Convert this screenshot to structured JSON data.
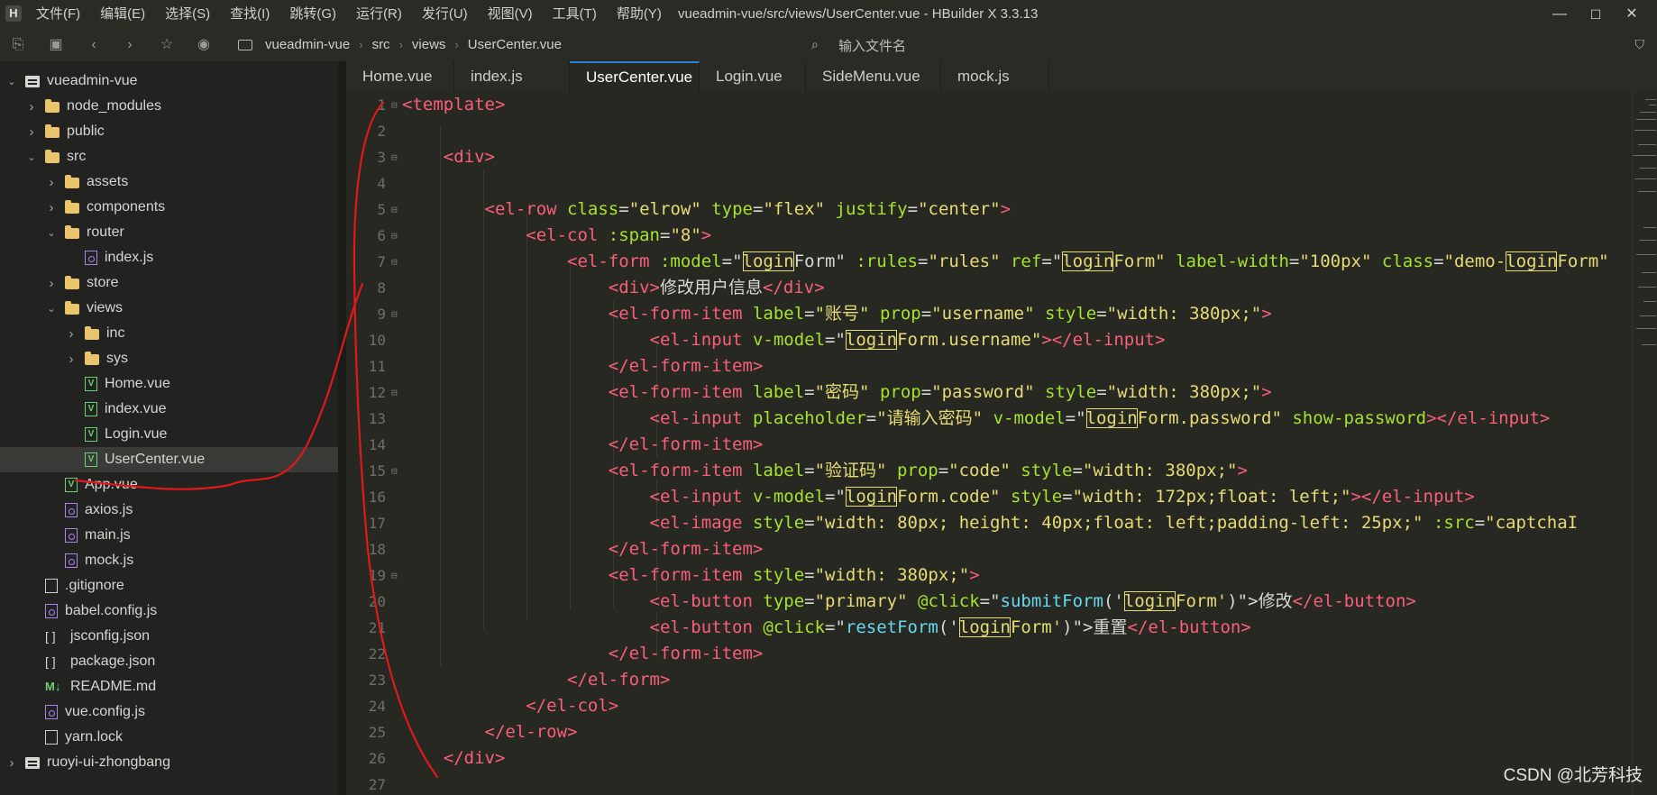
{
  "titlebar": {
    "logo": "H",
    "menu": [
      "文件(F)",
      "编辑(E)",
      "选择(S)",
      "查找(I)",
      "跳转(G)",
      "运行(R)",
      "发行(U)",
      "视图(V)",
      "工具(T)",
      "帮助(Y)"
    ],
    "window_title": "vueadmin-vue/src/views/UserCenter.vue - HBuilder X 3.3.13"
  },
  "toolbar": {
    "breadcrumb": [
      "vueadmin-vue",
      "src",
      "views",
      "UserCenter.vue"
    ],
    "search_placeholder": "输入文件名"
  },
  "sidebar": {
    "tree": [
      {
        "label": "vueadmin-vue",
        "depth": 0,
        "icon": "project",
        "chevron": "down"
      },
      {
        "label": "node_modules",
        "depth": 1,
        "icon": "folder",
        "chevron": "right"
      },
      {
        "label": "public",
        "depth": 1,
        "icon": "folder",
        "chevron": "right"
      },
      {
        "label": "src",
        "depth": 1,
        "icon": "folder",
        "chevron": "down"
      },
      {
        "label": "assets",
        "depth": 2,
        "icon": "folder",
        "chevron": "right"
      },
      {
        "label": "components",
        "depth": 2,
        "icon": "folder",
        "chevron": "right"
      },
      {
        "label": "router",
        "depth": 2,
        "icon": "folder",
        "chevron": "down"
      },
      {
        "label": "index.js",
        "depth": 3,
        "icon": "js",
        "chevron": "none"
      },
      {
        "label": "store",
        "depth": 2,
        "icon": "folder",
        "chevron": "right"
      },
      {
        "label": "views",
        "depth": 2,
        "icon": "folder",
        "chevron": "down"
      },
      {
        "label": "inc",
        "depth": 3,
        "icon": "folder",
        "chevron": "right"
      },
      {
        "label": "sys",
        "depth": 3,
        "icon": "folder",
        "chevron": "right"
      },
      {
        "label": "Home.vue",
        "depth": 3,
        "icon": "vue",
        "chevron": "none"
      },
      {
        "label": "index.vue",
        "depth": 3,
        "icon": "vue",
        "chevron": "none"
      },
      {
        "label": "Login.vue",
        "depth": 3,
        "icon": "vue",
        "chevron": "none"
      },
      {
        "label": "UserCenter.vue",
        "depth": 3,
        "icon": "vue",
        "chevron": "none",
        "selected": true
      },
      {
        "label": "App.vue",
        "depth": 2,
        "icon": "vue",
        "chevron": "none"
      },
      {
        "label": "axios.js",
        "depth": 2,
        "icon": "js",
        "chevron": "none"
      },
      {
        "label": "main.js",
        "depth": 2,
        "icon": "js",
        "chevron": "none"
      },
      {
        "label": "mock.js",
        "depth": 2,
        "icon": "js",
        "chevron": "none"
      },
      {
        "label": ".gitignore",
        "depth": 1,
        "icon": "doc",
        "chevron": "none"
      },
      {
        "label": "babel.config.js",
        "depth": 1,
        "icon": "js",
        "chevron": "none"
      },
      {
        "label": "jsconfig.json",
        "depth": 1,
        "icon": "json",
        "chevron": "none"
      },
      {
        "label": "package.json",
        "depth": 1,
        "icon": "json",
        "chevron": "none"
      },
      {
        "label": "README.md",
        "depth": 1,
        "icon": "md",
        "chevron": "none"
      },
      {
        "label": "vue.config.js",
        "depth": 1,
        "icon": "js",
        "chevron": "none"
      },
      {
        "label": "yarn.lock",
        "depth": 1,
        "icon": "doc",
        "chevron": "none"
      },
      {
        "label": "ruoyi-ui-zhongbang",
        "depth": 0,
        "icon": "project",
        "chevron": "right"
      }
    ]
  },
  "tabs": [
    {
      "label": "Home.vue",
      "active": false
    },
    {
      "label": "index.js",
      "active": false
    },
    {
      "label": "UserCenter.vue",
      "active": true
    },
    {
      "label": "Login.vue",
      "active": false
    },
    {
      "label": "SideMenu.vue",
      "active": false
    },
    {
      "label": "mock.js",
      "active": false
    }
  ],
  "editor": {
    "lines": [
      {
        "n": "1",
        "fold": true,
        "tokens": [
          [
            "t",
            "<template>"
          ]
        ]
      },
      {
        "n": "2",
        "tokens": []
      },
      {
        "n": "3",
        "fold": true,
        "tokens": [
          [
            "p",
            "    "
          ],
          [
            "t",
            "<div>"
          ]
        ]
      },
      {
        "n": "4",
        "tokens": []
      },
      {
        "n": "5",
        "fold": true,
        "tokens": [
          [
            "p",
            "        "
          ],
          [
            "t",
            "<el-row "
          ],
          [
            "a",
            "class"
          ],
          [
            "p",
            "="
          ],
          [
            "s",
            "\"elrow\""
          ],
          [
            "p",
            " "
          ],
          [
            "a",
            "type"
          ],
          [
            "p",
            "="
          ],
          [
            "s",
            "\"flex\""
          ],
          [
            "p",
            " "
          ],
          [
            "a",
            "justify"
          ],
          [
            "p",
            "="
          ],
          [
            "s",
            "\"center\""
          ],
          [
            "t",
            ">"
          ]
        ]
      },
      {
        "n": "6",
        "fold": true,
        "tokens": [
          [
            "p",
            "            "
          ],
          [
            "t",
            "<el-col "
          ],
          [
            "a",
            ":span"
          ],
          [
            "p",
            "="
          ],
          [
            "s",
            "\"8\""
          ],
          [
            "t",
            ">"
          ]
        ]
      },
      {
        "n": "7",
        "fold": true,
        "tokens": [
          [
            "p",
            "                "
          ],
          [
            "t",
            "<el-form "
          ],
          [
            "a",
            ":model"
          ],
          [
            "p",
            "=\""
          ],
          [
            "h",
            "login"
          ],
          [
            "p",
            "Form\" "
          ],
          [
            "a",
            ":rules"
          ],
          [
            "p",
            "="
          ],
          [
            "s",
            "\"rules\""
          ],
          [
            "p",
            " "
          ],
          [
            "a",
            "ref"
          ],
          [
            "p",
            "=\""
          ],
          [
            "h",
            "login"
          ],
          [
            "s",
            "Form\""
          ],
          [
            "p",
            " "
          ],
          [
            "a",
            "label-width"
          ],
          [
            "p",
            "="
          ],
          [
            "s",
            "\"100px\""
          ],
          [
            "p",
            " "
          ],
          [
            "a",
            "class"
          ],
          [
            "p",
            "="
          ],
          [
            "s",
            "\"demo-"
          ],
          [
            "h",
            "login"
          ],
          [
            "s",
            "Form\""
          ]
        ]
      },
      {
        "n": "8",
        "tokens": [
          [
            "p",
            "                    "
          ],
          [
            "t",
            "<div>"
          ],
          [
            "p",
            "修改用户信息"
          ],
          [
            "t",
            "</div>"
          ]
        ]
      },
      {
        "n": "9",
        "fold": true,
        "tokens": [
          [
            "p",
            "                    "
          ],
          [
            "t",
            "<el-form-item "
          ],
          [
            "a",
            "label"
          ],
          [
            "p",
            "="
          ],
          [
            "s",
            "\"账号\""
          ],
          [
            "p",
            " "
          ],
          [
            "a",
            "prop"
          ],
          [
            "p",
            "="
          ],
          [
            "s",
            "\"username\""
          ],
          [
            "p",
            " "
          ],
          [
            "a",
            "style"
          ],
          [
            "p",
            "="
          ],
          [
            "s",
            "\"width: 380px;\""
          ],
          [
            "t",
            ">"
          ]
        ]
      },
      {
        "n": "10",
        "tokens": [
          [
            "p",
            "                        "
          ],
          [
            "t",
            "<el-input "
          ],
          [
            "a",
            "v-model"
          ],
          [
            "p",
            "=\""
          ],
          [
            "h",
            "login"
          ],
          [
            "s",
            "Form.username\""
          ],
          [
            "t",
            "></el-input>"
          ]
        ]
      },
      {
        "n": "11",
        "tokens": [
          [
            "p",
            "                    "
          ],
          [
            "t",
            "</el-form-item>"
          ]
        ]
      },
      {
        "n": "12",
        "fold": true,
        "tokens": [
          [
            "p",
            "                    "
          ],
          [
            "t",
            "<el-form-item "
          ],
          [
            "a",
            "label"
          ],
          [
            "p",
            "="
          ],
          [
            "s",
            "\"密码\""
          ],
          [
            "p",
            " "
          ],
          [
            "a",
            "prop"
          ],
          [
            "p",
            "="
          ],
          [
            "s",
            "\"password\""
          ],
          [
            "p",
            " "
          ],
          [
            "a",
            "style"
          ],
          [
            "p",
            "="
          ],
          [
            "s",
            "\"width: 380px;\""
          ],
          [
            "t",
            ">"
          ]
        ]
      },
      {
        "n": "13",
        "tokens": [
          [
            "p",
            "                        "
          ],
          [
            "t",
            "<el-input "
          ],
          [
            "a",
            "placeholder"
          ],
          [
            "p",
            "="
          ],
          [
            "s",
            "\"请输入密码\""
          ],
          [
            "p",
            " "
          ],
          [
            "a",
            "v-model"
          ],
          [
            "p",
            "=\""
          ],
          [
            "h",
            "login"
          ],
          [
            "s",
            "Form.password\""
          ],
          [
            "p",
            " "
          ],
          [
            "a",
            "show-password"
          ],
          [
            "t",
            "></el-input>"
          ]
        ]
      },
      {
        "n": "14",
        "tokens": [
          [
            "p",
            "                    "
          ],
          [
            "t",
            "</el-form-item>"
          ]
        ]
      },
      {
        "n": "15",
        "fold": true,
        "tokens": [
          [
            "p",
            "                    "
          ],
          [
            "t",
            "<el-form-item "
          ],
          [
            "a",
            "label"
          ],
          [
            "p",
            "="
          ],
          [
            "s",
            "\"验证码\""
          ],
          [
            "p",
            " "
          ],
          [
            "a",
            "prop"
          ],
          [
            "p",
            "="
          ],
          [
            "s",
            "\"code\""
          ],
          [
            "p",
            " "
          ],
          [
            "a",
            "style"
          ],
          [
            "p",
            "="
          ],
          [
            "s",
            "\"width: 380px;\""
          ],
          [
            "t",
            ">"
          ]
        ]
      },
      {
        "n": "16",
        "tokens": [
          [
            "p",
            "                        "
          ],
          [
            "t",
            "<el-input "
          ],
          [
            "a",
            "v-model"
          ],
          [
            "p",
            "=\""
          ],
          [
            "h",
            "login"
          ],
          [
            "s",
            "Form.code\""
          ],
          [
            "p",
            " "
          ],
          [
            "a",
            "style"
          ],
          [
            "p",
            "="
          ],
          [
            "s",
            "\"width: 172px;float: left;\""
          ],
          [
            "t",
            "></el-input>"
          ]
        ]
      },
      {
        "n": "17",
        "tokens": [
          [
            "p",
            "                        "
          ],
          [
            "t",
            "<el-image "
          ],
          [
            "a",
            "style"
          ],
          [
            "p",
            "="
          ],
          [
            "s",
            "\"width: 80px; height: 40px;float: left;padding-left: 25px;\""
          ],
          [
            "p",
            " "
          ],
          [
            "a",
            ":src"
          ],
          [
            "p",
            "="
          ],
          [
            "s",
            "\"captchaI"
          ]
        ]
      },
      {
        "n": "18",
        "tokens": [
          [
            "p",
            "                    "
          ],
          [
            "t",
            "</el-form-item>"
          ]
        ]
      },
      {
        "n": "19",
        "fold": true,
        "tokens": [
          [
            "p",
            "                    "
          ],
          [
            "t",
            "<el-form-item "
          ],
          [
            "a",
            "style"
          ],
          [
            "p",
            "="
          ],
          [
            "s",
            "\"width: 380px;\""
          ],
          [
            "t",
            ">"
          ]
        ]
      },
      {
        "n": "20",
        "tokens": [
          [
            "p",
            "                        "
          ],
          [
            "t",
            "<el-button "
          ],
          [
            "a",
            "type"
          ],
          [
            "p",
            "="
          ],
          [
            "s",
            "\"primary\""
          ],
          [
            "p",
            " "
          ],
          [
            "a",
            "@click"
          ],
          [
            "p",
            "=\""
          ],
          [
            "f",
            "submitForm"
          ],
          [
            "p",
            "('"
          ],
          [
            "h",
            "login"
          ],
          [
            "s",
            "Form'"
          ],
          [
            "p",
            ")\">"
          ],
          [
            "p",
            "修改"
          ],
          [
            "t",
            "</el-button>"
          ]
        ]
      },
      {
        "n": "21",
        "tokens": [
          [
            "p",
            "                        "
          ],
          [
            "t",
            "<el-button "
          ],
          [
            "a",
            "@click"
          ],
          [
            "p",
            "=\""
          ],
          [
            "f",
            "resetForm"
          ],
          [
            "p",
            "('"
          ],
          [
            "h",
            "login"
          ],
          [
            "s",
            "Form'"
          ],
          [
            "p",
            ")\">"
          ],
          [
            "p",
            "重置"
          ],
          [
            "t",
            "</el-button>"
          ]
        ]
      },
      {
        "n": "22",
        "tokens": [
          [
            "p",
            "                    "
          ],
          [
            "t",
            "</el-form-item>"
          ]
        ]
      },
      {
        "n": "23",
        "tokens": [
          [
            "p",
            "                "
          ],
          [
            "t",
            "</el-form>"
          ]
        ]
      },
      {
        "n": "24",
        "tokens": [
          [
            "p",
            "            "
          ],
          [
            "t",
            "</el-col>"
          ]
        ]
      },
      {
        "n": "25",
        "tokens": [
          [
            "p",
            "        "
          ],
          [
            "t",
            "</el-row>"
          ]
        ]
      },
      {
        "n": "26",
        "tokens": [
          [
            "p",
            "    "
          ],
          [
            "t",
            "</div>"
          ]
        ]
      },
      {
        "n": "27",
        "tokens": []
      }
    ]
  },
  "watermark": "CSDN @北芳科技",
  "colors": {
    "tag": "#f95f7a",
    "attr": "#a6e22e",
    "string": "#e6db74",
    "function": "#66d9ef",
    "annotation": "#e0191b"
  }
}
